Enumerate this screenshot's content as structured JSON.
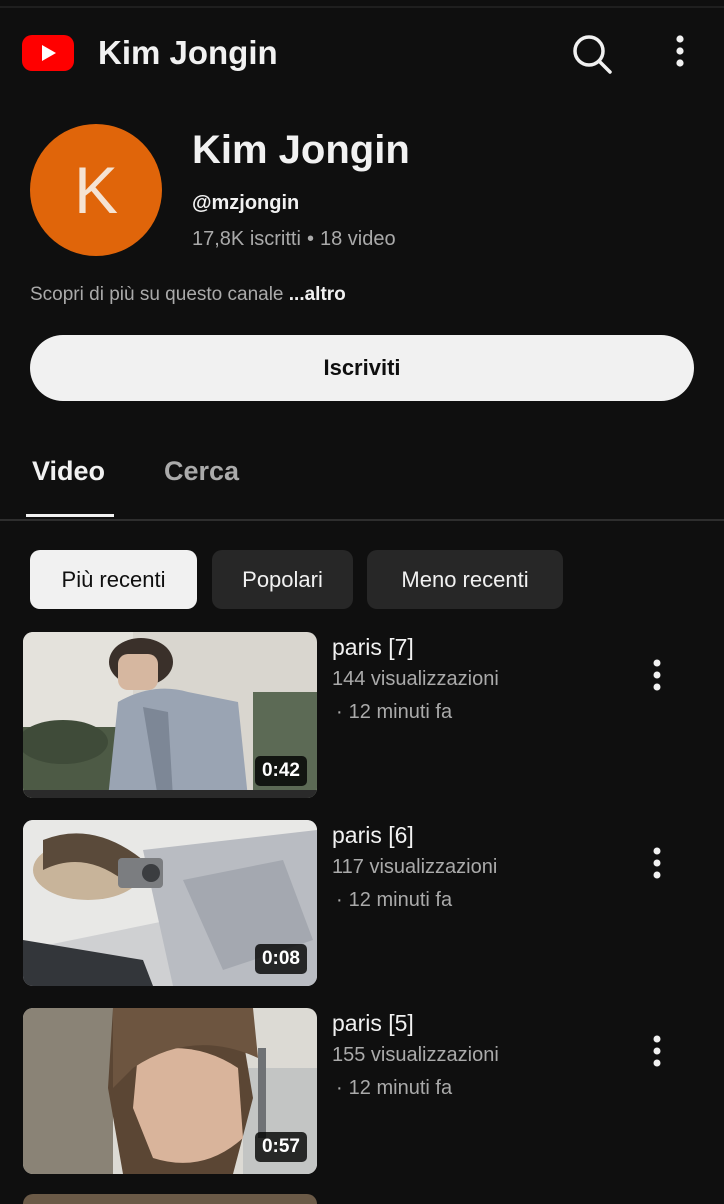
{
  "header": {
    "logo_icon": "youtube-logo-icon",
    "title": "Kim Jongin",
    "search_icon": "search-icon",
    "more_icon": "more-vertical-icon"
  },
  "channel": {
    "avatar_letter": "K",
    "avatar_color": "#e0650a",
    "name": "Kim Jongin",
    "handle": "@mzjongin",
    "subscribers": "17,8K iscritti",
    "video_count": "18 video",
    "stats_separator": "•",
    "description": "Scopri di più su questo canale",
    "description_more": "...altro",
    "subscribe_label": "Iscriviti"
  },
  "tabs": [
    {
      "label": "Video",
      "active": true
    },
    {
      "label": "Cerca",
      "active": false
    }
  ],
  "chips": [
    {
      "label": "Più recenti",
      "active": true
    },
    {
      "label": "Popolari",
      "active": false
    },
    {
      "label": "Meno recenti",
      "active": false
    }
  ],
  "videos": [
    {
      "title": "paris [7]",
      "views": "144 visualizzazioni",
      "time": "12 minuti fa",
      "duration": "0:42"
    },
    {
      "title": "paris [6]",
      "views": "117 visualizzazioni",
      "time": "12 minuti fa",
      "duration": "0:08"
    },
    {
      "title": "paris [5]",
      "views": "155 visualizzazioni",
      "time": "12 minuti fa",
      "duration": "0:57"
    }
  ],
  "colors": {
    "background": "#0f0f0f",
    "brand_red": "#ff0000",
    "text_primary": "#f1f1f1",
    "text_secondary": "#aaaaaa",
    "chip_inactive": "#272727"
  }
}
